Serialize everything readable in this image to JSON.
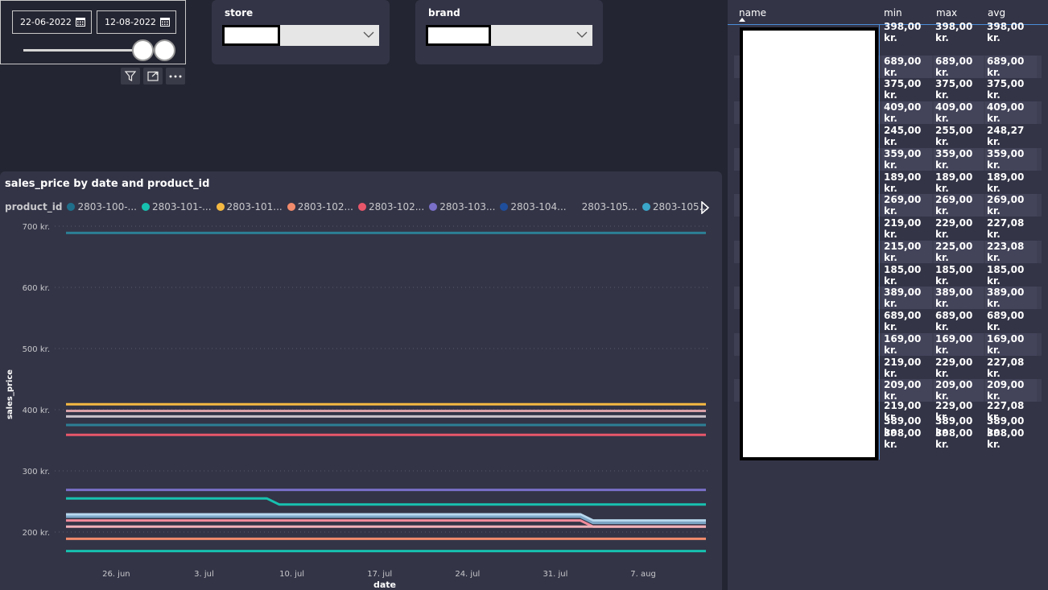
{
  "date_slicer": {
    "start_date": "22-06-2022",
    "end_date": "12-08-2022",
    "calendar_icon": "calendar-icon"
  },
  "visual_header": {
    "filter_icon": "filter-icon",
    "focus_icon": "focus-mode-icon",
    "more_icon": "more-options-icon"
  },
  "store_slicer": {
    "title": "store"
  },
  "brand_slicer": {
    "title": "brand"
  },
  "chart": {
    "title": "sales_price by date and product_id",
    "legend_title": "product_id",
    "xlabel": "date",
    "ylabel": "sales_price"
  },
  "chart_data": {
    "type": "line",
    "title": "sales_price by date and product_id",
    "xlabel": "date",
    "ylabel": "sales_price",
    "ylim": [
      150,
      700
    ],
    "y_ticks": [
      200,
      300,
      400,
      500,
      600,
      700
    ],
    "y_tick_labels": [
      "200 kr.",
      "300 kr.",
      "400 kr.",
      "500 kr.",
      "600 kr.",
      "700 kr."
    ],
    "x_range": [
      "2022-06-22",
      "2022-08-12"
    ],
    "x_ticks": [
      "2022-06-26",
      "2022-07-03",
      "2022-07-10",
      "2022-07-17",
      "2022-07-24",
      "2022-07-31",
      "2022-08-07"
    ],
    "x_tick_labels": [
      "26. jun",
      "3. jul",
      "10. jul",
      "17. jul",
      "24. jul",
      "31. jul",
      "7. aug"
    ],
    "grid": "horizontal dotted",
    "legend_position": "top",
    "legend_entries": [
      {
        "label": "2803-100-...",
        "color": "#1f6f8b"
      },
      {
        "label": "2803-101-...",
        "color": "#17c1b0"
      },
      {
        "label": "2803-101...",
        "color": "#f5b942"
      },
      {
        "label": "2803-102...",
        "color": "#f28b6c"
      },
      {
        "label": "2803-102...",
        "color": "#e8566a"
      },
      {
        "label": "2803-103...",
        "color": "#7a6fc9"
      },
      {
        "label": "2803-104...",
        "color": "#1f4e9c"
      },
      {
        "label": "2803-105...",
        "color": ""
      },
      {
        "label": "2803-105...",
        "color": "#3aa6c9"
      }
    ],
    "series": [
      {
        "color": "#2c7f95",
        "points": [
          [
            "2022-06-22",
            689
          ],
          [
            "2022-08-12",
            689
          ]
        ]
      },
      {
        "color": "#f5b942",
        "points": [
          [
            "2022-06-22",
            409
          ],
          [
            "2022-08-12",
            409
          ]
        ]
      },
      {
        "color": "#d9a0a8",
        "points": [
          [
            "2022-06-22",
            398
          ],
          [
            "2022-08-12",
            398
          ]
        ]
      },
      {
        "color": "#c9c2c9",
        "points": [
          [
            "2022-06-22",
            389
          ],
          [
            "2022-08-12",
            389
          ]
        ]
      },
      {
        "color": "#2c7f95",
        "points": [
          [
            "2022-06-22",
            375
          ],
          [
            "2022-08-12",
            375
          ]
        ]
      },
      {
        "color": "#e8566a",
        "points": [
          [
            "2022-06-22",
            359
          ],
          [
            "2022-08-12",
            359
          ]
        ]
      },
      {
        "color": "#7a6fc9",
        "points": [
          [
            "2022-06-22",
            269
          ],
          [
            "2022-08-12",
            269
          ]
        ]
      },
      {
        "color": "#17c1b0",
        "points": [
          [
            "2022-06-22",
            255
          ],
          [
            "2022-07-08",
            255
          ],
          [
            "2022-07-09",
            245
          ],
          [
            "2022-08-12",
            245
          ]
        ]
      },
      {
        "color": "#b8d8ee",
        "points": [
          [
            "2022-06-22",
            229
          ],
          [
            "2022-08-02",
            229
          ],
          [
            "2022-08-03",
            219
          ],
          [
            "2022-08-12",
            219
          ]
        ]
      },
      {
        "color": "#7ea8c9",
        "points": [
          [
            "2022-06-22",
            225
          ],
          [
            "2022-08-02",
            225
          ],
          [
            "2022-08-03",
            215
          ],
          [
            "2022-08-12",
            215
          ]
        ]
      },
      {
        "color": "#f28b9c",
        "points": [
          [
            "2022-06-22",
            219
          ],
          [
            "2022-08-02",
            219
          ],
          [
            "2022-08-03",
            209
          ],
          [
            "2022-08-12",
            209
          ]
        ]
      },
      {
        "color": "#f0b0b8",
        "points": [
          [
            "2022-06-22",
            209
          ],
          [
            "2022-08-12",
            209
          ]
        ]
      },
      {
        "color": "#f28b6c",
        "points": [
          [
            "2022-06-22",
            189
          ],
          [
            "2022-08-12",
            189
          ]
        ]
      },
      {
        "color": "#17c1b0",
        "points": [
          [
            "2022-06-22",
            169
          ],
          [
            "2022-08-12",
            169
          ]
        ]
      }
    ]
  },
  "table": {
    "columns": [
      "name",
      "min",
      "max",
      "avg"
    ],
    "rows": [
      [
        "398,00 kr.",
        "398,00 kr.",
        "398,00 kr."
      ],
      [
        "689,00 kr.",
        "689,00 kr.",
        "689,00 kr."
      ],
      [
        "375,00 kr.",
        "375,00 kr.",
        "375,00 kr."
      ],
      [
        "409,00 kr.",
        "409,00 kr.",
        "409,00 kr."
      ],
      [
        "245,00 kr.",
        "255,00 kr.",
        "248,27 kr."
      ],
      [
        "359,00 kr.",
        "359,00 kr.",
        "359,00 kr."
      ],
      [
        "189,00 kr.",
        "189,00 kr.",
        "189,00 kr."
      ],
      [
        "269,00 kr.",
        "269,00 kr.",
        "269,00 kr."
      ],
      [
        "219,00 kr.",
        "229,00 kr.",
        "227,08 kr."
      ],
      [
        "215,00 kr.",
        "225,00 kr.",
        "223,08 kr."
      ],
      [
        "185,00 kr.",
        "185,00 kr.",
        "185,00 kr."
      ],
      [
        "389,00 kr.",
        "389,00 kr.",
        "389,00 kr."
      ],
      [
        "689,00 kr.",
        "689,00 kr.",
        "689,00 kr."
      ],
      [
        "169,00 kr.",
        "169,00 kr.",
        "169,00 kr."
      ],
      [
        "219,00 kr.",
        "229,00 kr.",
        "227,08 kr."
      ],
      [
        "209,00 kr.",
        "209,00 kr.",
        "209,00 kr."
      ],
      [
        "219,00 kr.",
        "229,00 kr.",
        "227,08 kr."
      ],
      [
        "389,00 kr.",
        "389,00 kr.",
        "389,00 kr."
      ],
      [
        "398,00 kr.",
        "398,00 kr.",
        "398,00 kr."
      ]
    ]
  },
  "colors": {
    "background": "#242532",
    "card": "#333446",
    "accent": "#4a8cd8"
  }
}
